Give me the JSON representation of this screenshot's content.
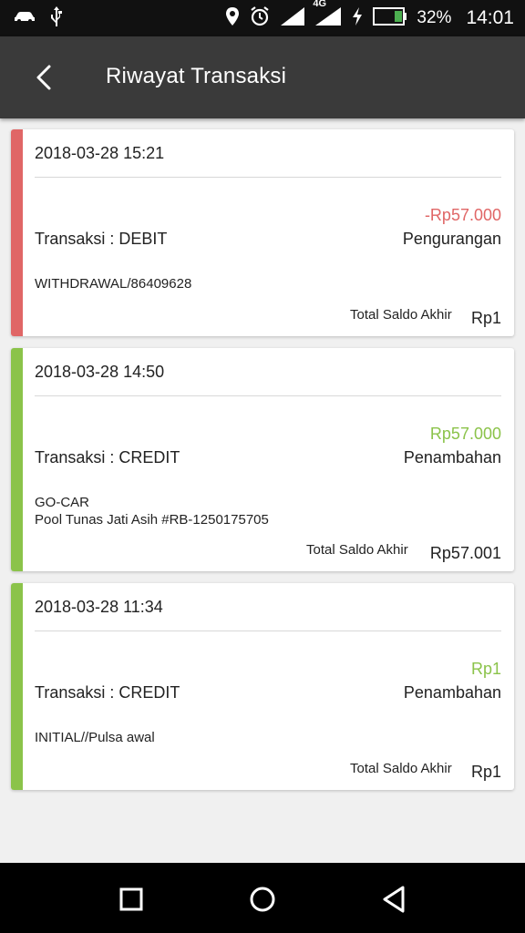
{
  "status_bar": {
    "battery_percent": "32%",
    "time": "14:01",
    "network": "4G",
    "icons": [
      "car-icon",
      "usb-icon",
      "location-icon",
      "alarm-icon",
      "signal-icon",
      "signal-4g-icon",
      "charging-icon",
      "battery-icon"
    ]
  },
  "header": {
    "title": "Riwayat Transaksi",
    "back_icon": "back-arrow-icon"
  },
  "colors": {
    "debit": "#e06666",
    "credit": "#8bc34a",
    "app_bar": "#3a3a3a"
  },
  "transactions": [
    {
      "datetime": "2018-03-28 15:21",
      "amount": "-Rp57.000",
      "type_label": "Transaksi : DEBIT",
      "kind": "Pengurangan",
      "description_line1": "WITHDRAWAL/86409628",
      "description_line2": "",
      "total_label": "Total Saldo Akhir",
      "total_value": "Rp1",
      "status": "debit"
    },
    {
      "datetime": "2018-03-28 14:50",
      "amount": "Rp57.000",
      "type_label": "Transaksi : CREDIT",
      "kind": "Penambahan",
      "description_line1": "GO-CAR",
      "description_line2": "Pool Tunas Jati Asih #RB-1250175705",
      "total_label": "Total Saldo Akhir",
      "total_value": "Rp57.001",
      "status": "credit"
    },
    {
      "datetime": "2018-03-28 11:34",
      "amount": "Rp1",
      "type_label": "Transaksi : CREDIT",
      "kind": "Penambahan",
      "description_line1": "INITIAL//Pulsa awal",
      "description_line2": "",
      "total_label": "Total Saldo Akhir",
      "total_value": "Rp1",
      "status": "credit"
    }
  ],
  "nav_bar": {
    "icons": [
      "recent-apps-icon",
      "home-icon",
      "back-icon"
    ]
  }
}
